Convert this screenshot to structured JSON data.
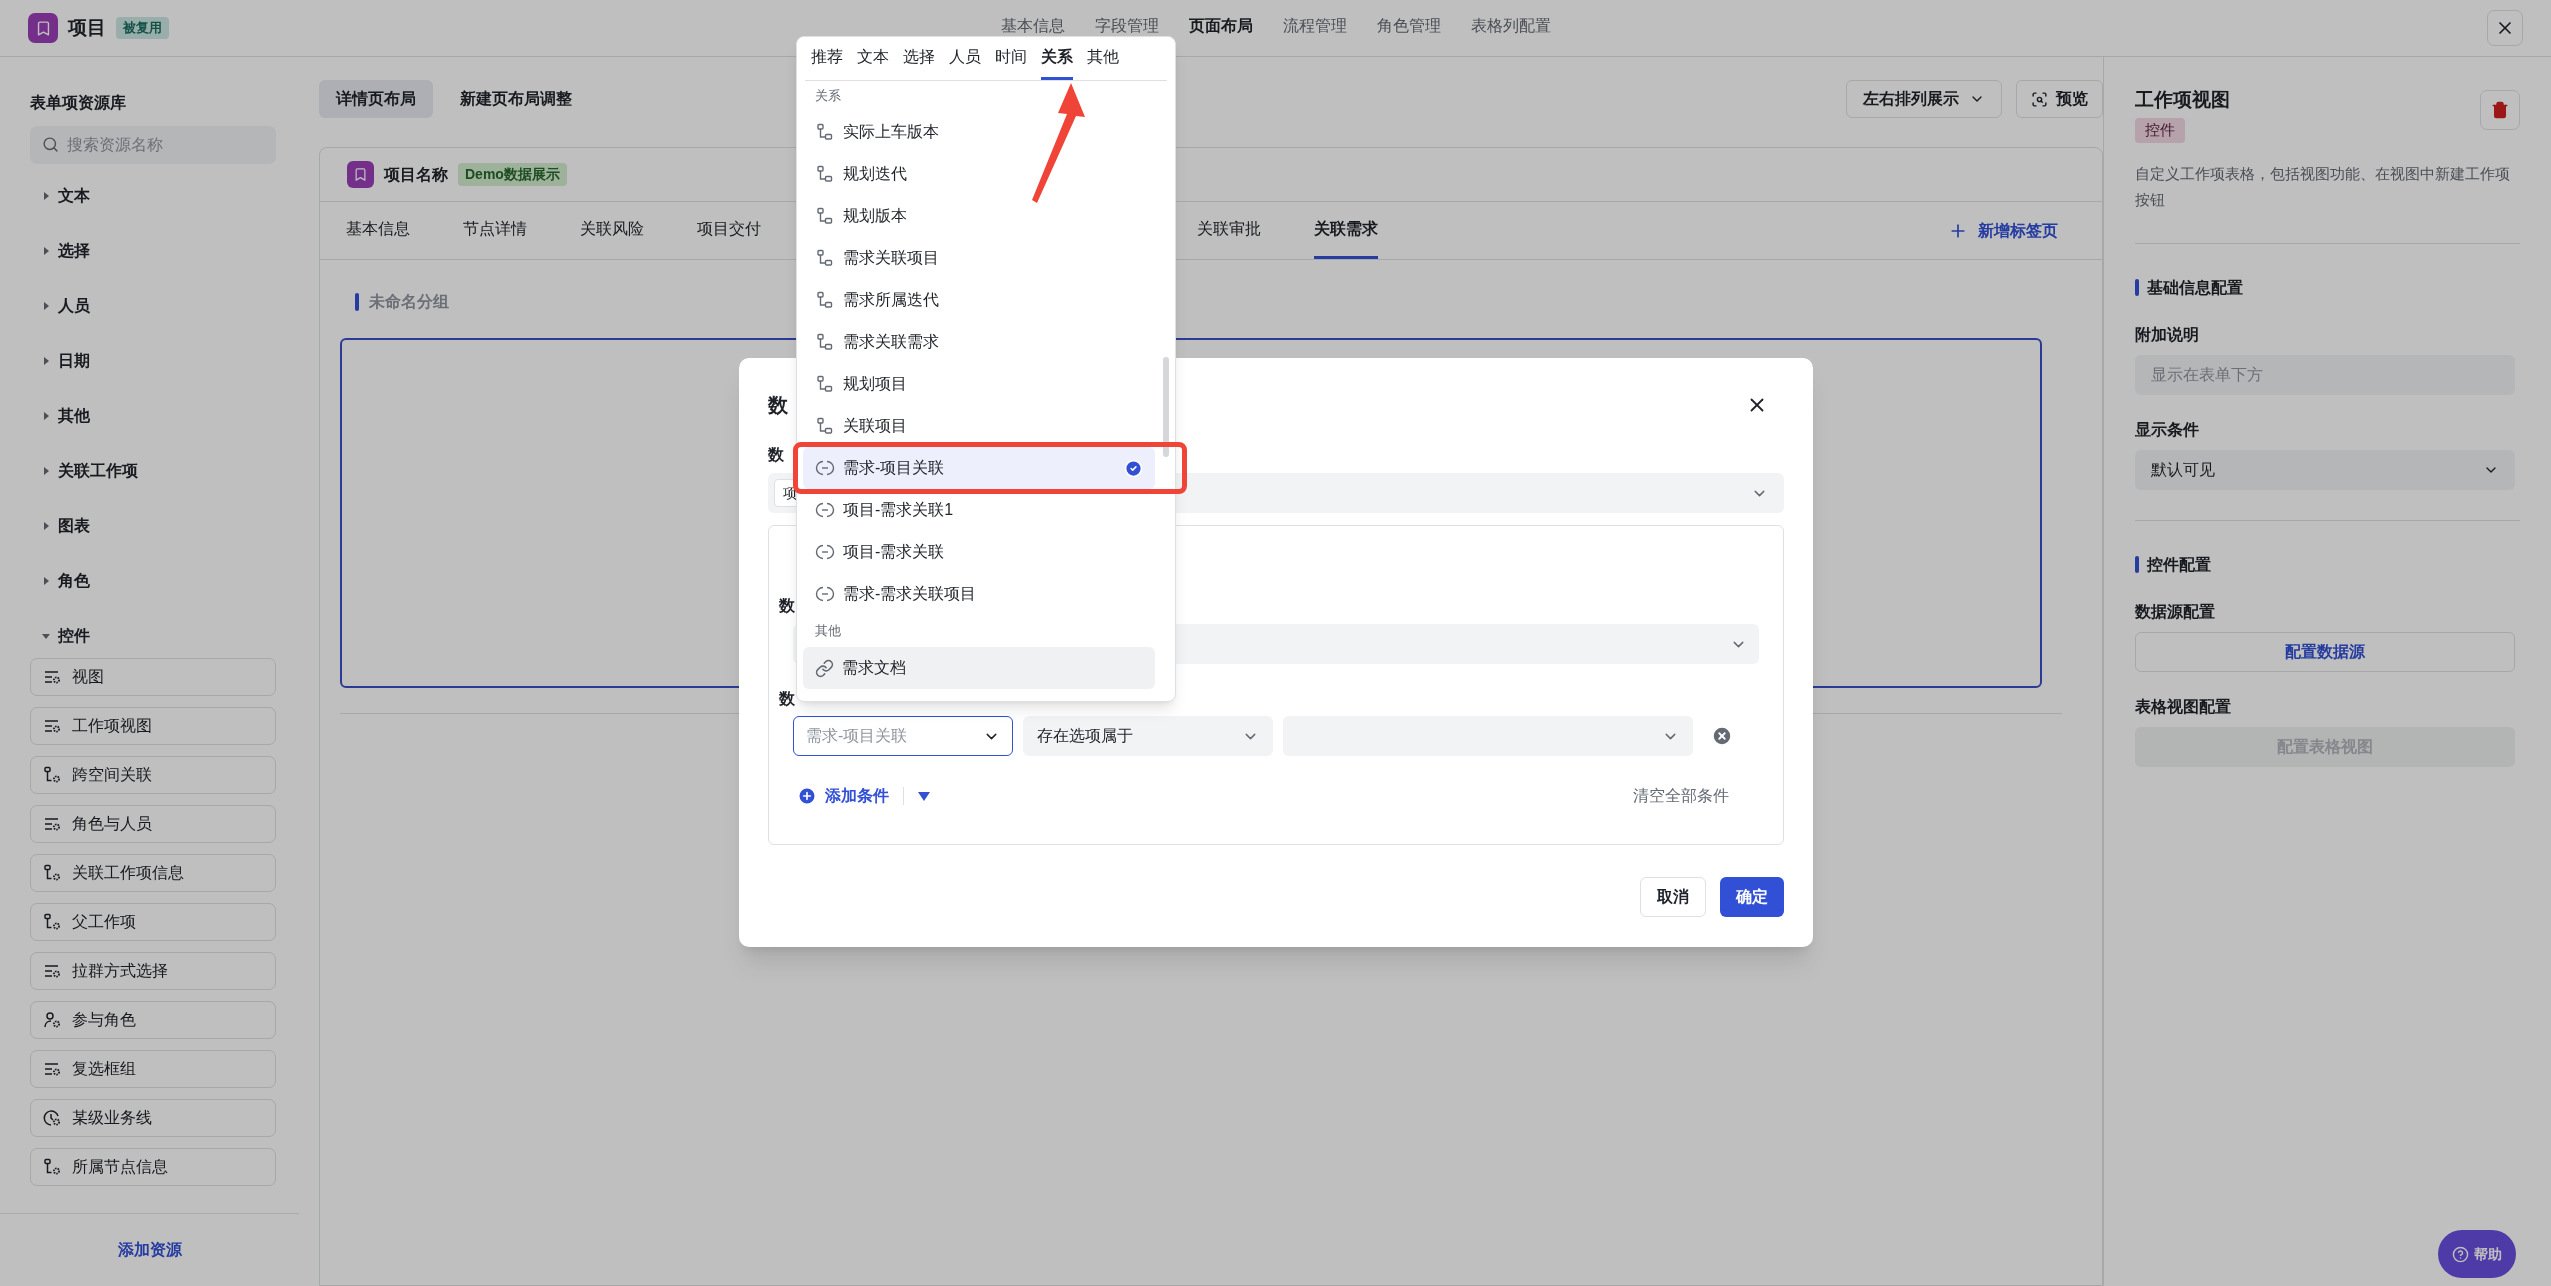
{
  "header": {
    "title": "项目",
    "badge": "被复用",
    "nav": [
      {
        "label": "基本信息",
        "selected": false
      },
      {
        "label": "字段管理",
        "selected": false
      },
      {
        "label": "页面布局",
        "selected": true
      },
      {
        "label": "流程管理",
        "selected": false
      },
      {
        "label": "角色管理",
        "selected": false
      },
      {
        "label": "表格列配置",
        "selected": false
      }
    ]
  },
  "sidebar": {
    "title": "表单项资源库",
    "search": {
      "placeholder": "搜索资源名称"
    },
    "categories": [
      {
        "label": "文本",
        "expanded": false
      },
      {
        "label": "选择",
        "expanded": false
      },
      {
        "label": "人员",
        "expanded": false
      },
      {
        "label": "日期",
        "expanded": false
      },
      {
        "label": "其他",
        "expanded": false
      },
      {
        "label": "关联工作项",
        "expanded": false
      },
      {
        "label": "图表",
        "expanded": false
      },
      {
        "label": "角色",
        "expanded": false
      },
      {
        "label": "控件",
        "expanded": true,
        "children": [
          {
            "label": "视图",
            "kind": "list"
          },
          {
            "label": "工作项视图",
            "kind": "list"
          },
          {
            "label": "跨空间关联",
            "kind": "tree"
          },
          {
            "label": "角色与人员",
            "kind": "list"
          },
          {
            "label": "关联工作项信息",
            "kind": "tree"
          },
          {
            "label": "父工作项",
            "kind": "tree"
          },
          {
            "label": "拉群方式选择",
            "kind": "list"
          },
          {
            "label": "参与角色",
            "kind": "person"
          },
          {
            "label": "复选框组",
            "kind": "list"
          },
          {
            "label": "某级业务线",
            "kind": "clock"
          },
          {
            "label": "所属节点信息",
            "kind": "tree"
          }
        ]
      }
    ],
    "add_button": "添加资源"
  },
  "layout_tabs": [
    {
      "label": "详情页布局",
      "selected": true
    },
    {
      "label": "新建页布局调整",
      "selected": false
    }
  ],
  "arrange_select": "左右排列展示",
  "preview_button": "预览",
  "card": {
    "title": "项目名称",
    "badge": "Demo数据展示",
    "tabs": [
      {
        "label": "基本信息",
        "selected": false
      },
      {
        "label": "节点详情",
        "selected": false
      },
      {
        "label": "关联风险",
        "selected": false
      },
      {
        "label": "项目交付",
        "selected": false
      },
      {
        "label": "关联审批",
        "selected": false
      },
      {
        "label": "关联需求",
        "selected": true
      }
    ],
    "add_tab": "新增标签页",
    "group_title": "未命名分组"
  },
  "right_panel": {
    "title": "工作项视图",
    "badge": "控件",
    "description": "自定义工作项表格，包括视图功能、在视图中新建工作项按钮",
    "sections": [
      {
        "title": "基础信息配置",
        "fields": [
          {
            "label": "附加说明",
            "kind": "input",
            "placeholder": "显示在表单下方"
          },
          {
            "label": "显示条件",
            "kind": "select",
            "value": "默认可见"
          }
        ]
      },
      {
        "title": "控件配置",
        "fields": [
          {
            "label": "数据源配置",
            "kind": "button",
            "value": "配置数据源",
            "disabled": false
          },
          {
            "label": "表格视图配置",
            "kind": "button",
            "value": "配置表格视图",
            "disabled": true
          }
        ]
      }
    ]
  },
  "modal": {
    "title": "数",
    "field_label": "数",
    "source_chip": "项",
    "group": {
      "label_1": "数",
      "label_2": "数",
      "condition": {
        "field": "需求-项目关联",
        "operator": "存在选项属于"
      },
      "add_condition": "添加条件",
      "clear_all": "清空全部条件"
    },
    "buttons": [
      {
        "label": "取消",
        "kind": "secondary"
      },
      {
        "label": "确定",
        "kind": "primary"
      }
    ]
  },
  "dropdown": {
    "tabs": [
      {
        "label": "推荐",
        "selected": false
      },
      {
        "label": "文本",
        "selected": false
      },
      {
        "label": "选择",
        "selected": false
      },
      {
        "label": "人员",
        "selected": false
      },
      {
        "label": "时间",
        "selected": false
      },
      {
        "label": "关系",
        "selected": true
      },
      {
        "label": "其他",
        "selected": false
      }
    ],
    "groups": [
      {
        "label": "关系",
        "items": [
          {
            "label": "实际上车版本",
            "kind": "tree",
            "selected": false,
            "hovered": false
          },
          {
            "label": "规划迭代",
            "kind": "tree",
            "selected": false,
            "hovered": false
          },
          {
            "label": "规划版本",
            "kind": "tree",
            "selected": false,
            "hovered": false
          },
          {
            "label": "需求关联项目",
            "kind": "tree",
            "selected": false,
            "hovered": false
          },
          {
            "label": "需求所属迭代",
            "kind": "tree",
            "selected": false,
            "hovered": false
          },
          {
            "label": "需求关联需求",
            "kind": "tree",
            "selected": false,
            "hovered": false
          },
          {
            "label": "规划项目",
            "kind": "tree",
            "selected": false,
            "hovered": false
          },
          {
            "label": "关联项目",
            "kind": "tree",
            "selected": false,
            "hovered": false
          },
          {
            "label": "需求-项目关联",
            "kind": "relation",
            "selected": true,
            "hovered": false
          },
          {
            "label": "项目-需求关联1",
            "kind": "relation",
            "selected": false,
            "hovered": false
          },
          {
            "label": "项目-需求关联",
            "kind": "relation",
            "selected": false,
            "hovered": false
          },
          {
            "label": "需求-需求关联项目",
            "kind": "relation",
            "selected": false,
            "hovered": false
          }
        ]
      },
      {
        "label": "其他",
        "items": [
          {
            "label": "需求文档",
            "kind": "link",
            "selected": false,
            "hovered": true
          }
        ]
      }
    ]
  },
  "help_button": "帮助"
}
